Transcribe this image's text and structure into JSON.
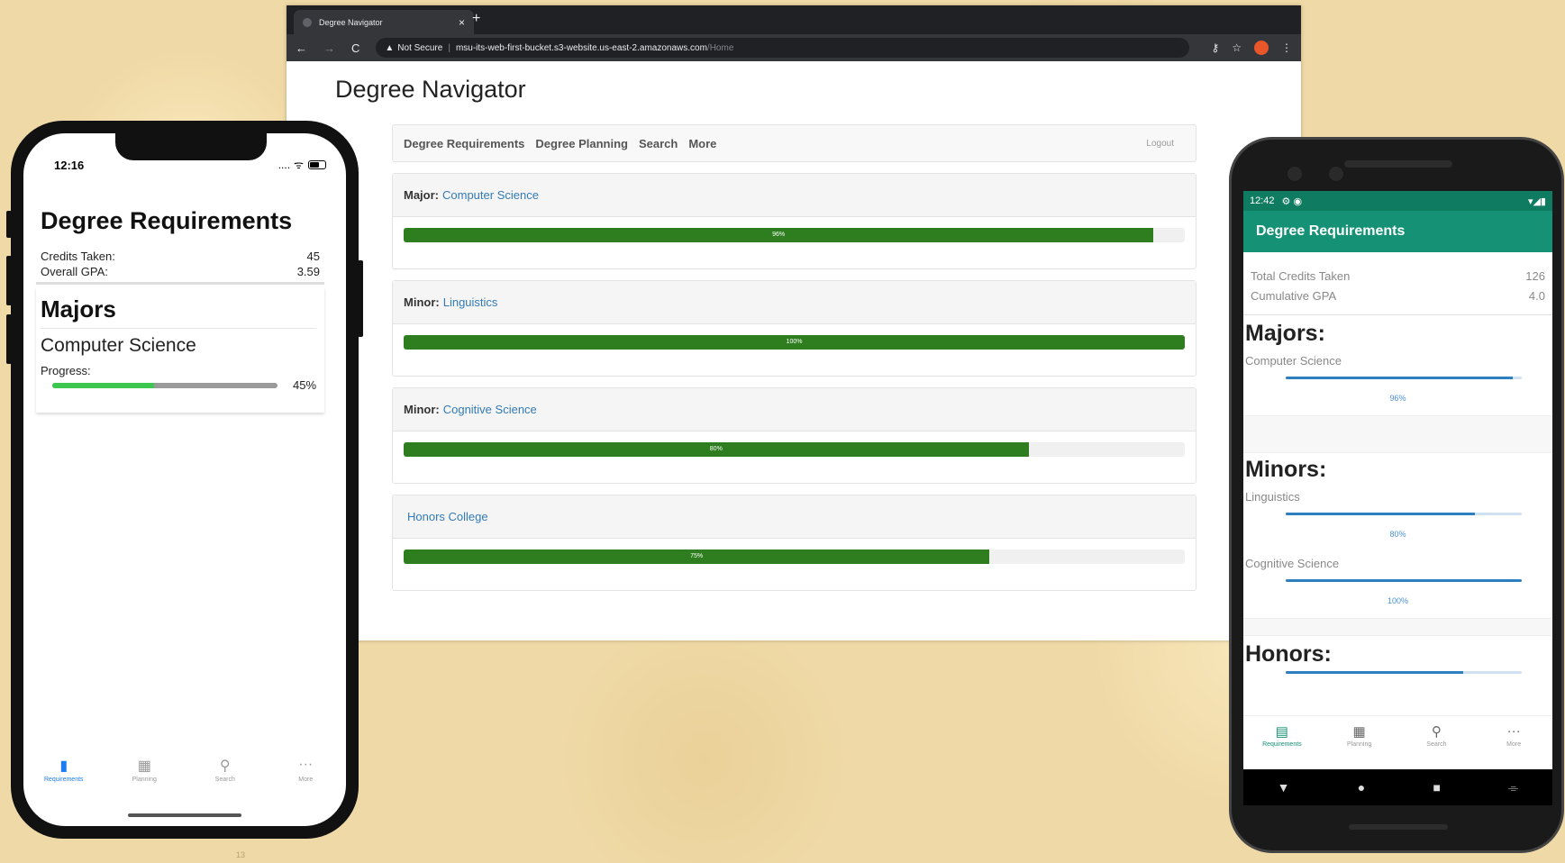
{
  "browser": {
    "tab_title": "Degree Navigator",
    "tab_close": "×",
    "new_tab": "+",
    "back": "←",
    "forward": "→",
    "reload": "C",
    "security_icon": "▲",
    "security_text": "Not Secure",
    "separator": "|",
    "url_host": "msu-its-web-first-bucket.s3-website.us-east-2.amazonaws.com",
    "url_path": "/Home",
    "key_icon": "⚷",
    "star_icon": "☆",
    "menu_icon": "⋮"
  },
  "web": {
    "title": "Degree Navigator",
    "nav": [
      "Degree Requirements",
      "Degree Planning",
      "Search",
      "More"
    ],
    "logout": "Logout",
    "cards": [
      {
        "kind": "Major:",
        "name": "Computer Science",
        "label": "96%",
        "value": 96
      },
      {
        "kind": "Minor:",
        "name": "Linguistics",
        "label": "100%",
        "value": 100
      },
      {
        "kind": "Minor:",
        "name": "Cognitive Science",
        "label": "80%",
        "value": 80
      },
      {
        "kind": "",
        "name": "Honors College",
        "label": "75%",
        "value": 75
      }
    ]
  },
  "ios": {
    "time": "12:16",
    "signal": "....",
    "wifi": "ᯤ",
    "title": "Degree Requirements",
    "credits_label": "Credits Taken:",
    "credits_value": "45",
    "gpa_label": "Overall GPA:",
    "gpa_value": "3.59",
    "majors_title": "Majors",
    "major_name": "Computer Science",
    "progress_label": "Progress:",
    "progress_pct": "45%",
    "progress_value": 45,
    "tabs": [
      {
        "label": "Requirements",
        "icon": "▮"
      },
      {
        "label": "Planning",
        "icon": "▦"
      },
      {
        "label": "Search",
        "icon": "⚲"
      },
      {
        "label": "More",
        "icon": "···"
      }
    ]
  },
  "android": {
    "time": "12:42",
    "status_icons": "⚙ ◉",
    "status_right": "▾◢▮",
    "title": "Degree Requirements",
    "credits_label": "Total Credits Taken",
    "credits_value": "126",
    "gpa_label": "Cumulative GPA",
    "gpa_value": "4.0",
    "majors_title": "Majors:",
    "major_name": "Computer Science",
    "major_pct": "96%",
    "major_value": 96,
    "minors_title": "Minors:",
    "minors": [
      {
        "name": "Linguistics",
        "pct": "80%",
        "value": 80
      },
      {
        "name": "Cognitive Science",
        "pct": "100%",
        "value": 100
      }
    ],
    "honors_title": "Honors:",
    "honors_value": 75,
    "tabs": [
      {
        "label": "Requirements",
        "icon": "▤"
      },
      {
        "label": "Planning",
        "icon": "▦"
      },
      {
        "label": "Search",
        "icon": "⚲"
      },
      {
        "label": "More",
        "icon": "···"
      }
    ],
    "sysnav": [
      "▼",
      "●",
      "■",
      "⌯"
    ]
  },
  "page_number": "13"
}
